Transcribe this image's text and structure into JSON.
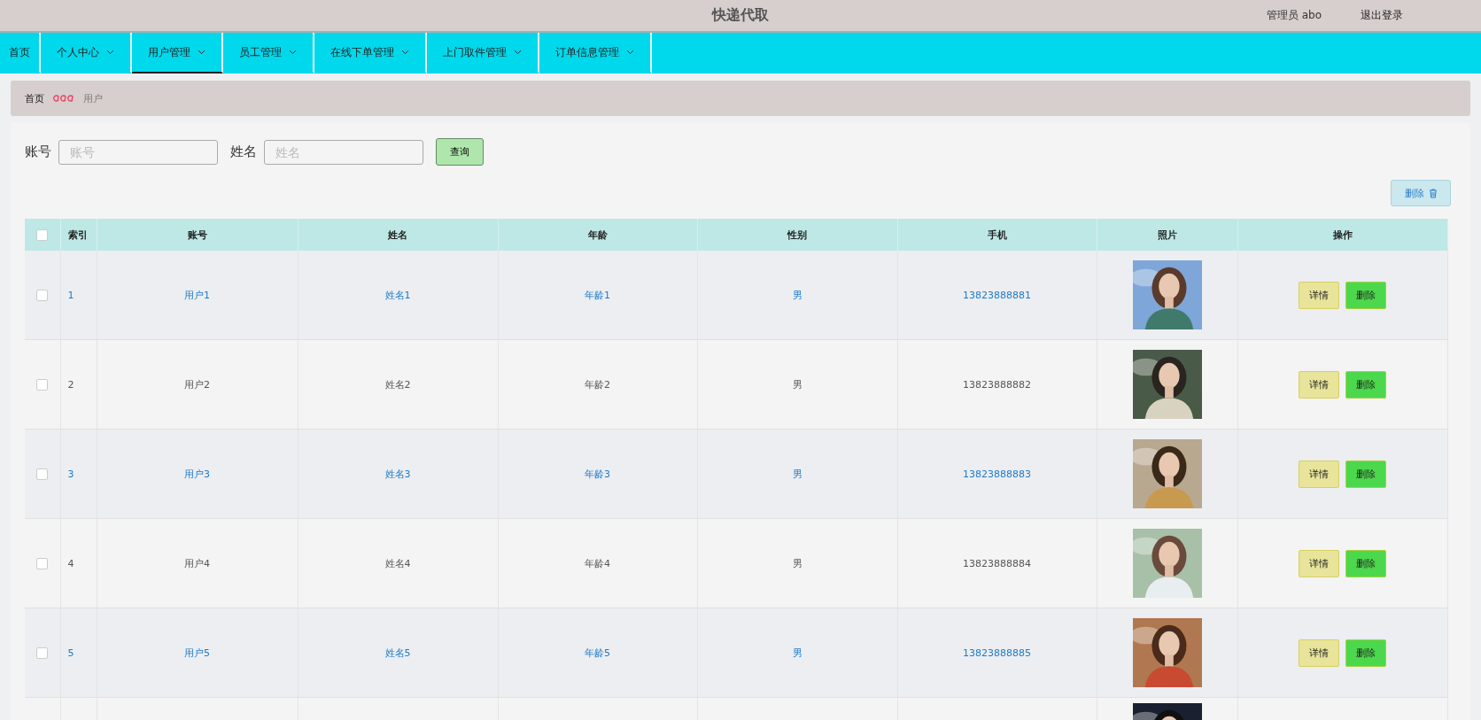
{
  "header": {
    "title": "快递代取",
    "user": "管理员 abo",
    "logout": "退出登录"
  },
  "nav": [
    {
      "label": "首页",
      "dropdown": false,
      "selected": false
    },
    {
      "label": "个人中心",
      "dropdown": true,
      "selected": false
    },
    {
      "label": "用户管理",
      "dropdown": true,
      "selected": true
    },
    {
      "label": "员工管理",
      "dropdown": true,
      "selected": false
    },
    {
      "label": "在线下单管理",
      "dropdown": true,
      "selected": false
    },
    {
      "label": "上门取件管理",
      "dropdown": true,
      "selected": false
    },
    {
      "label": "订单信息管理",
      "dropdown": true,
      "selected": false
    }
  ],
  "breadcrumb": {
    "home": "首页",
    "current": "用户"
  },
  "search": {
    "fields": [
      {
        "label": "账号",
        "placeholder": "账号"
      },
      {
        "label": "姓名",
        "placeholder": "姓名"
      }
    ],
    "button": "查询"
  },
  "bulk_delete": "删除",
  "table": {
    "columns": [
      "索引",
      "账号",
      "姓名",
      "年龄",
      "性别",
      "手机",
      "照片",
      "操作"
    ],
    "header_checked": false,
    "rows": [
      {
        "highlighted": true,
        "checked": false,
        "cells": [
          "1",
          "用户1",
          "姓名1",
          "年龄1",
          "男",
          "13823888881"
        ],
        "photo": {
          "kind": "picture"
        },
        "actions": [
          "详情",
          "删除"
        ]
      },
      {
        "highlighted": false,
        "checked": false,
        "cells": [
          "2",
          "用户2",
          "姓名2",
          "年龄2",
          "男",
          "13823888882"
        ],
        "photo": {
          "kind": "picture"
        },
        "actions": [
          "详情",
          "删除"
        ]
      },
      {
        "highlighted": true,
        "checked": false,
        "cells": [
          "3",
          "用户3",
          "姓名3",
          "年龄3",
          "男",
          "13823888883"
        ],
        "photo": {
          "kind": "picture"
        },
        "actions": [
          "详情",
          "删除"
        ]
      },
      {
        "highlighted": false,
        "checked": false,
        "cells": [
          "4",
          "用户4",
          "姓名4",
          "年龄4",
          "男",
          "13823888884"
        ],
        "photo": {
          "kind": "picture"
        },
        "actions": [
          "详情",
          "删除"
        ]
      },
      {
        "highlighted": true,
        "checked": false,
        "cells": [
          "5",
          "用户5",
          "姓名5",
          "年龄5",
          "男",
          "13823888885"
        ],
        "photo": {
          "kind": "picture"
        },
        "actions": [
          "详情",
          "删除"
        ]
      },
      {
        "photo": {
          "kind": "picture"
        }
      }
    ]
  }
}
